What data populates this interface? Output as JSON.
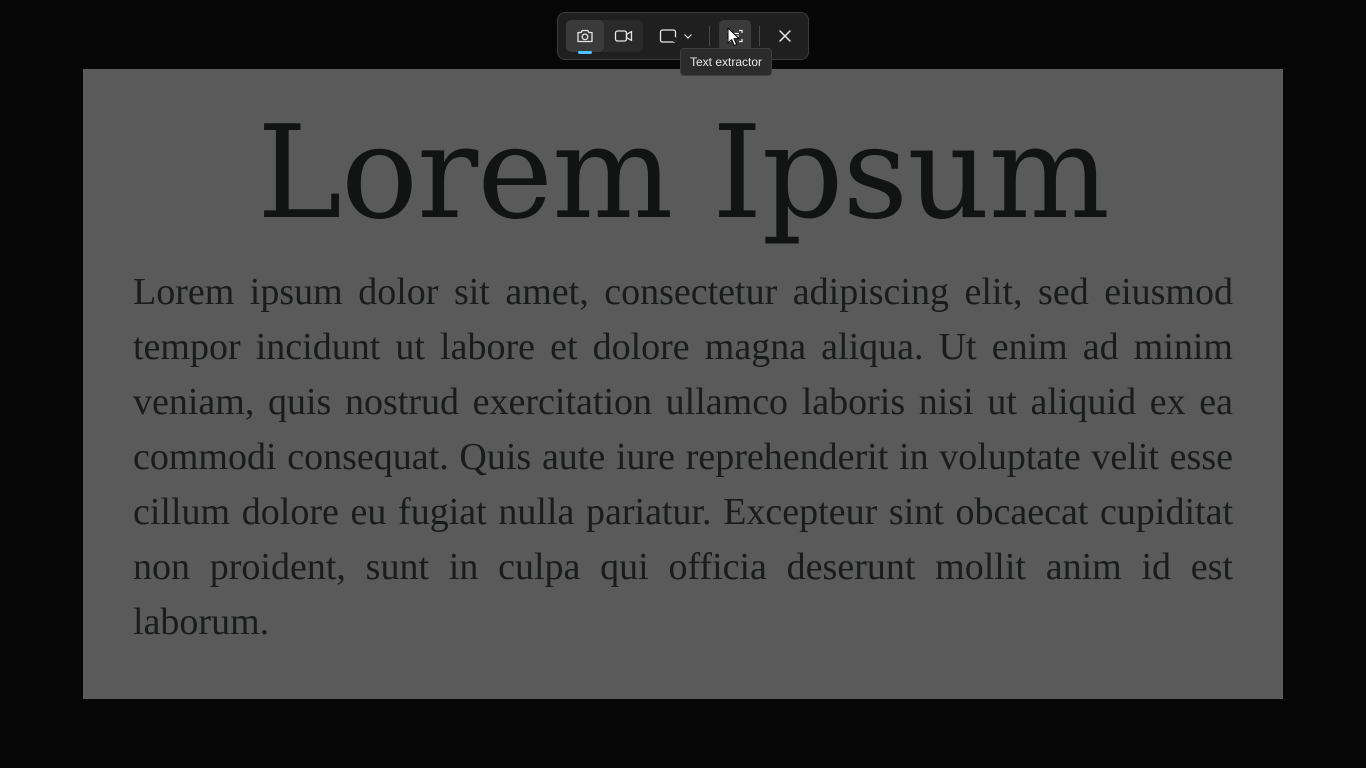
{
  "capture": {
    "title": "Lorem Ipsum",
    "body": "Lorem ipsum dolor sit amet, consectetur adipiscing elit, sed eiusmod tempor incidunt ut labore et dolore magna aliqua. Ut enim ad minim veniam, quis nostrud exercitation ullamco laboris nisi ut aliquid ex ea commodi consequat. Quis aute iure reprehenderit in voluptate velit esse cillum dolore eu fugiat nulla pariatur. Excepteur sint obcaecat cupiditat non proident, sunt in culpa qui officia deserunt mollit anim id est laborum."
  },
  "toolbar": {
    "buttons": [
      {
        "id": "screenshot",
        "icon": "camera-icon",
        "active": true
      },
      {
        "id": "record",
        "icon": "video-camera-icon",
        "active": false
      },
      {
        "id": "snip-shape",
        "icon": "rectangle-snip-icon",
        "active": false
      },
      {
        "id": "text-extractor",
        "icon": "text-extractor-icon",
        "active": false
      },
      {
        "id": "close",
        "icon": "close-icon",
        "active": false
      }
    ],
    "tooltip": "Text extractor"
  },
  "colors": {
    "accent": "#4cc2ff",
    "toolbar_bg": "#1f1f1f",
    "overlay_bg": "#5a5a5a"
  }
}
